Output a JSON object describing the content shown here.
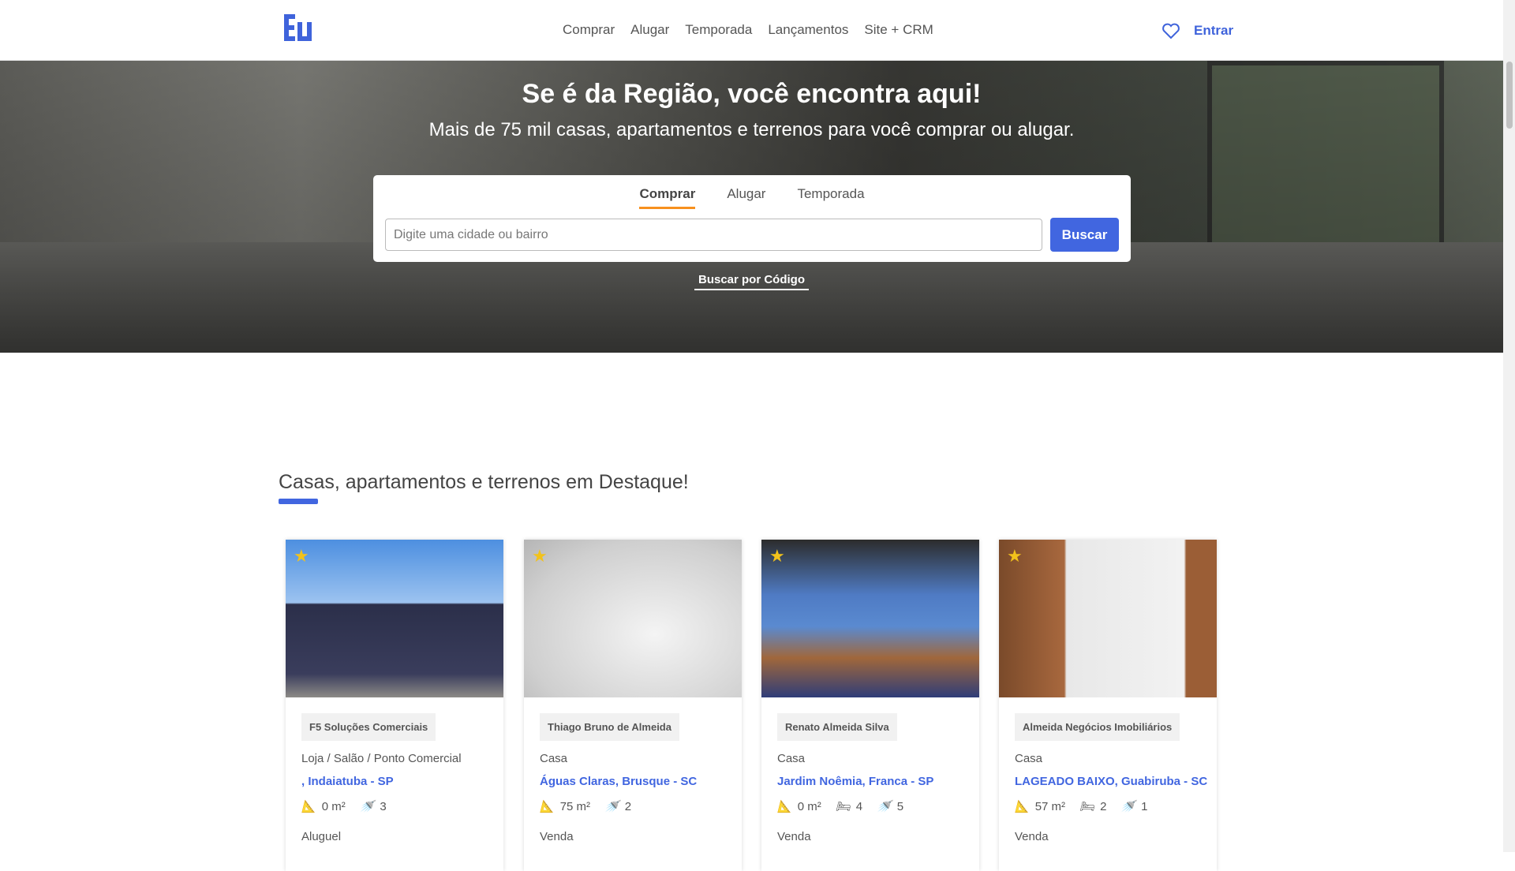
{
  "nav": {
    "logo": "Eu",
    "links": [
      "Comprar",
      "Alugar",
      "Temporada",
      "Lançamentos",
      "Site + CRM"
    ],
    "login": "Entrar"
  },
  "hero": {
    "title": "Se é da Região, você encontra aqui!",
    "subtitle": "Mais de 75 mil casas, apartamentos e terrenos para você comprar ou alugar.",
    "tabs": [
      "Comprar",
      "Alugar",
      "Temporada"
    ],
    "search_placeholder": "Digite uma cidade ou bairro",
    "search_button": "Buscar",
    "code_link": "Buscar por Código"
  },
  "featured": {
    "title": "Casas, apartamentos e terrenos em Destaque!",
    "cards": [
      {
        "agency": "F5 Soluções Comerciais",
        "type": "Loja / Salão / Ponto Comercial",
        "location": ", Indaiatuba - SP",
        "area": "0 m²",
        "bathrooms": "3",
        "deal": "Aluguel"
      },
      {
        "agency": "Thiago Bruno de Almeida",
        "type": "Casa",
        "location": "Águas Claras, Brusque - SC",
        "area": "75 m²",
        "bathrooms": "2",
        "deal": "Venda"
      },
      {
        "agency": "Renato Almeida Silva",
        "type": "Casa",
        "location": "Jardim Noêmia, Franca - SP",
        "area": "0 m²",
        "bedrooms": "4",
        "bathrooms": "5",
        "deal": "Venda"
      },
      {
        "agency": "Almeida Negócios Imobiliários",
        "type": "Casa",
        "location": "LAGEADO BAIXO, Guabiruba - SC",
        "area": "57 m²",
        "bedrooms": "2",
        "bathrooms": "1",
        "deal": "Venda"
      }
    ]
  },
  "colors": {
    "brand": "#4166e0",
    "tab_accent": "#f7901e",
    "star": "#f2c21b"
  }
}
